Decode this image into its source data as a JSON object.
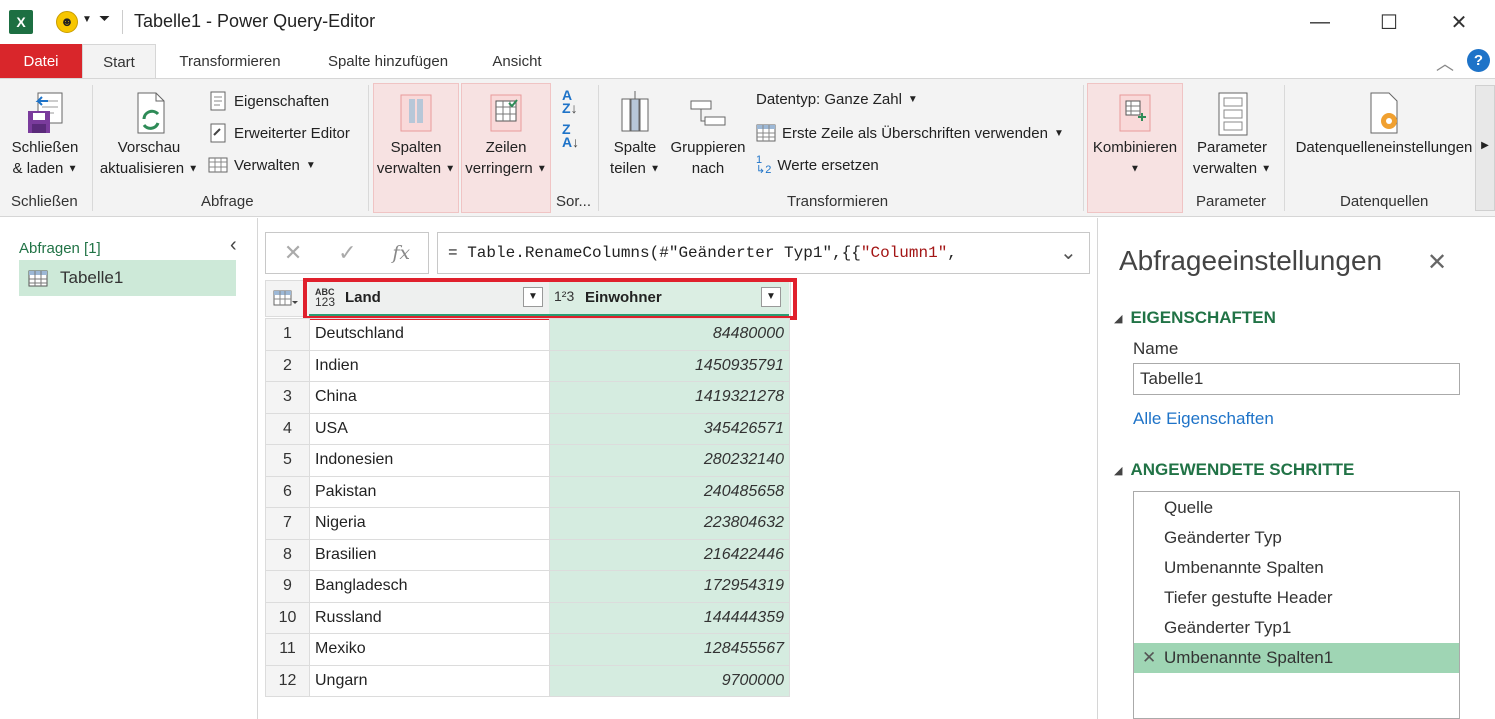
{
  "window": {
    "title": "Tabelle1 - Power Query-Editor"
  },
  "tabs": [
    "Datei",
    "Start",
    "Transformieren",
    "Spalte hinzufügen",
    "Ansicht"
  ],
  "ribbon": {
    "close_load": {
      "line1": "Schließen",
      "line2": "& laden"
    },
    "preview": {
      "line1": "Vorschau",
      "line2": "aktualisieren"
    },
    "properties": "Eigenschaften",
    "advanced_editor": "Erweiterter Editor",
    "manage": "Verwalten",
    "manage_columns": {
      "line1": "Spalten",
      "line2": "verwalten"
    },
    "reduce_rows": {
      "line1": "Zeilen",
      "line2": "verringern"
    },
    "split_column": {
      "line1": "Spalte",
      "line2": "teilen"
    },
    "group_by": {
      "line1": "Gruppieren",
      "line2": "nach"
    },
    "data_type": "Datentyp: Ganze Zahl",
    "first_row_headers": "Erste Zeile als Überschriften verwenden",
    "replace_values": "Werte ersetzen",
    "combine": "Kombinieren",
    "manage_params": {
      "line1": "Parameter",
      "line2": "verwalten"
    },
    "datasource_settings": "Datenquelleneinstellungen",
    "groups": {
      "close": "Schließen",
      "query": "Abfrage",
      "sort": "Sor...",
      "transform": "Transformieren",
      "parameter": "Parameter",
      "datasources": "Datenquellen"
    }
  },
  "queries": {
    "header": "Abfragen [1]",
    "items": [
      "Tabelle1"
    ]
  },
  "formula": {
    "prefix": "= Table.RenameColumns(#\"Geänderter Typ1\",{{",
    "string": "\"Column1\"",
    "suffix": ","
  },
  "grid": {
    "columns": [
      {
        "type_icon": "ABC/123",
        "name": "Land"
      },
      {
        "type_icon": "1²3",
        "name": "Einwohner"
      }
    ],
    "rows": [
      {
        "n": "1",
        "land": "Deutschland",
        "ein": "84480000"
      },
      {
        "n": "2",
        "land": "Indien",
        "ein": "1450935791"
      },
      {
        "n": "3",
        "land": "China",
        "ein": "1419321278"
      },
      {
        "n": "4",
        "land": "USA",
        "ein": "345426571"
      },
      {
        "n": "5",
        "land": "Indonesien",
        "ein": "280232140"
      },
      {
        "n": "6",
        "land": "Pakistan",
        "ein": "240485658"
      },
      {
        "n": "7",
        "land": "Nigeria",
        "ein": "223804632"
      },
      {
        "n": "8",
        "land": "Brasilien",
        "ein": "216422446"
      },
      {
        "n": "9",
        "land": "Bangladesch",
        "ein": "172954319"
      },
      {
        "n": "10",
        "land": "Russland",
        "ein": "144444359"
      },
      {
        "n": "11",
        "land": "Mexiko",
        "ein": "128455567"
      },
      {
        "n": "12",
        "land": "Ungarn",
        "ein": "9700000"
      }
    ]
  },
  "settings": {
    "title": "Abfrageeinstellungen",
    "properties_header": "EIGENSCHAFTEN",
    "name_label": "Name",
    "name_value": "Tabelle1",
    "all_properties": "Alle Eigenschaften",
    "steps_header": "ANGEWENDETE SCHRITTE",
    "steps": [
      "Quelle",
      "Geänderter Typ",
      "Umbenannte Spalten",
      "Tiefer gestufte Header",
      "Geänderter Typ1",
      "Umbenannte Spalten1"
    ]
  },
  "colors": {
    "accent_green": "#217346",
    "file_red": "#d9262b",
    "highlight_red": "#e0202c",
    "selected_step": "#9fd5b4",
    "numeric_column": "#d5ece0"
  }
}
